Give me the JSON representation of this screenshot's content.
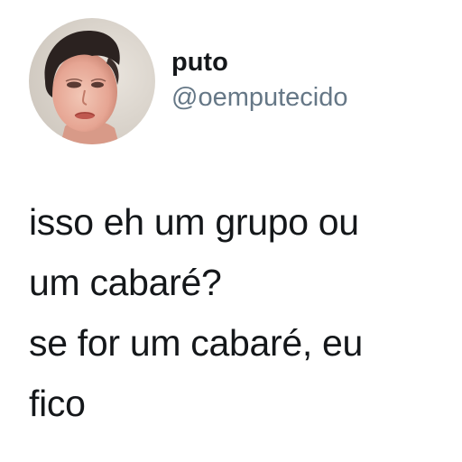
{
  "author": {
    "display_name": "puto",
    "handle": "@oemputecido",
    "avatar_icon": "profile-photo"
  },
  "tweet": {
    "lines": [
      "isso eh um grupo ou",
      "um cabaré?",
      "se for um cabaré, eu",
      "fico"
    ]
  },
  "colors": {
    "name": "#14171a",
    "handle": "#657786",
    "background": "#ffffff"
  }
}
